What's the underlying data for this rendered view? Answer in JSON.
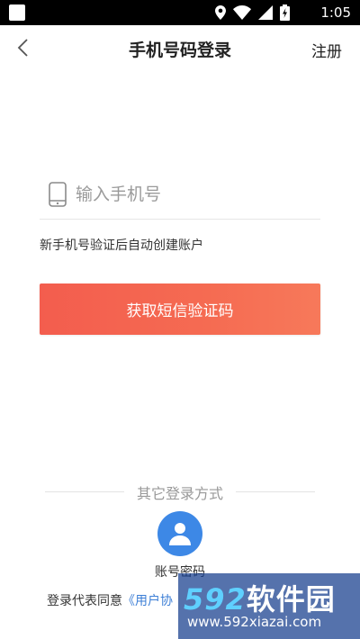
{
  "status_bar": {
    "time": "1:05",
    "icons": [
      "location-icon",
      "wifi-icon",
      "signal-icon",
      "battery-icon"
    ]
  },
  "nav": {
    "title": "手机号码登录",
    "register_label": "注册"
  },
  "phone_input": {
    "placeholder": "输入手机号",
    "value": ""
  },
  "hint": "新手机号验证后自动创建账户",
  "sms_button_label": "获取短信验证码",
  "other_login": {
    "label": "其它登录方式",
    "account_label": "账号密码"
  },
  "agreement": {
    "prefix": "登录代表同意",
    "link": "《用户协"
  },
  "watermark": {
    "number": "592",
    "text": "软件园",
    "url": "www.592xiazai.com"
  },
  "colors": {
    "accent_button": "#f35d4e",
    "account_icon": "#3d88e6",
    "link": "#3d7fd6"
  }
}
